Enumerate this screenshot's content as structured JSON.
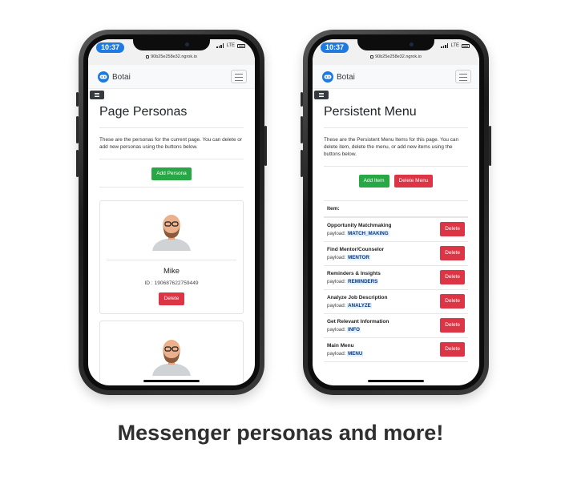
{
  "phones": {
    "left": {
      "status": {
        "time": "10:37",
        "network": "LTE",
        "url": "90b25e258e32.ngrok.io"
      },
      "brand": "Botai",
      "page_title": "Page Personas",
      "description": "These are the personas for the current page. You can delete or add new personas using the buttons below.",
      "add_button": "Add Persona",
      "personas": [
        {
          "name": "Mike",
          "id": "ID : 190687622759449",
          "delete_label": "Delete"
        }
      ]
    },
    "right": {
      "status": {
        "time": "10:37",
        "network": "LTE",
        "url": "90b25e258e32.ngrok.io"
      },
      "brand": "Botai",
      "page_title": "Persistent Menu",
      "description": "These are the Persistent Menu Items for this page. You can delete item, delete the menu, or add new items using the buttons below.",
      "add_button": "Add Item",
      "delete_menu_button": "Delete Menu",
      "table_header": "Item:",
      "payload_label": "payload:",
      "items": [
        {
          "title": "Opportunity Matchmaking",
          "payload": "MATCH_MAKING",
          "delete_label": "Delete"
        },
        {
          "title": "Find Mentor/Counselor",
          "payload": "MENTOR",
          "delete_label": "Delete"
        },
        {
          "title": "Reminders & Insights",
          "payload": "REMINDERS",
          "delete_label": "Delete"
        },
        {
          "title": "Analyze Job Description",
          "payload": "ANALYZE",
          "delete_label": "Delete"
        },
        {
          "title": "Get Relevant Information",
          "payload": "INFO",
          "delete_label": "Delete"
        },
        {
          "title": "Main Menu",
          "payload": "MENU",
          "delete_label": "Delete"
        }
      ]
    }
  },
  "caption": "Messenger personas and more!",
  "colors": {
    "brand_blue": "#1f7ae0",
    "success": "#28a745",
    "danger": "#dc3545",
    "navbar_bg": "#f8f9fa"
  },
  "icons": [
    "lock-icon",
    "signal-icon",
    "battery-icon",
    "botai-logo-icon",
    "hamburger-menu-icon",
    "sidebar-toggle-icon",
    "avatar-icon"
  ]
}
